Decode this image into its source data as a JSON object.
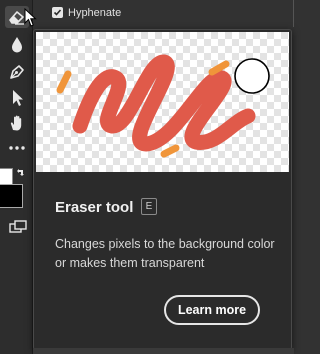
{
  "options_bar": {
    "hyphenate_label": "Hyphenate",
    "hyphenate_checked": true
  },
  "tools": [
    {
      "icon": "eraser-icon",
      "active": true
    },
    {
      "icon": "blur-drop-icon"
    },
    {
      "icon": "pen-icon"
    },
    {
      "icon": "selection-arrow-icon"
    },
    {
      "icon": "hand-icon"
    },
    {
      "icon": "more-tools-icon"
    }
  ],
  "colors": {
    "foreground": "#ffffff",
    "background": "#000000",
    "stroke_red": "#e05a4a",
    "stroke_orange": "#f0953a"
  },
  "tooltip": {
    "tool_name": "Eraser tool",
    "shortcut": "E",
    "description": "Changes pixels to the background color or makes them transparent",
    "learn_more_label": "Learn more"
  }
}
